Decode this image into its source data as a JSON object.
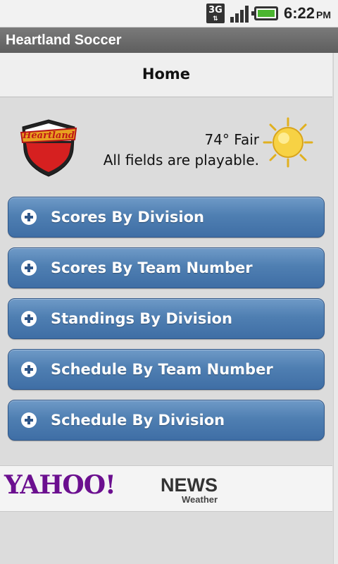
{
  "status_bar": {
    "network": "3G",
    "time": "6:22",
    "ampm": "PM",
    "icons": [
      "3g-icon",
      "signal-icon",
      "battery-icon"
    ]
  },
  "app": {
    "title": "Heartland Soccer"
  },
  "page": {
    "title": "Home"
  },
  "weather": {
    "temperature": "74° Fair",
    "status": "All fields are playable.",
    "icon": "sun-icon"
  },
  "menu": {
    "items": [
      {
        "label": "Scores By Division"
      },
      {
        "label": "Scores By Team Number"
      },
      {
        "label": "Standings By Division"
      },
      {
        "label": "Schedule By Team Number"
      },
      {
        "label": "Schedule By Division"
      }
    ]
  },
  "footer": {
    "brand": "YAHOO!",
    "news": "NEWS",
    "weather": "Weather"
  },
  "colors": {
    "button_blue": "#4f7fb2",
    "title_bar": "#6b6b6b",
    "yahoo_purple": "#6b0f8f"
  }
}
